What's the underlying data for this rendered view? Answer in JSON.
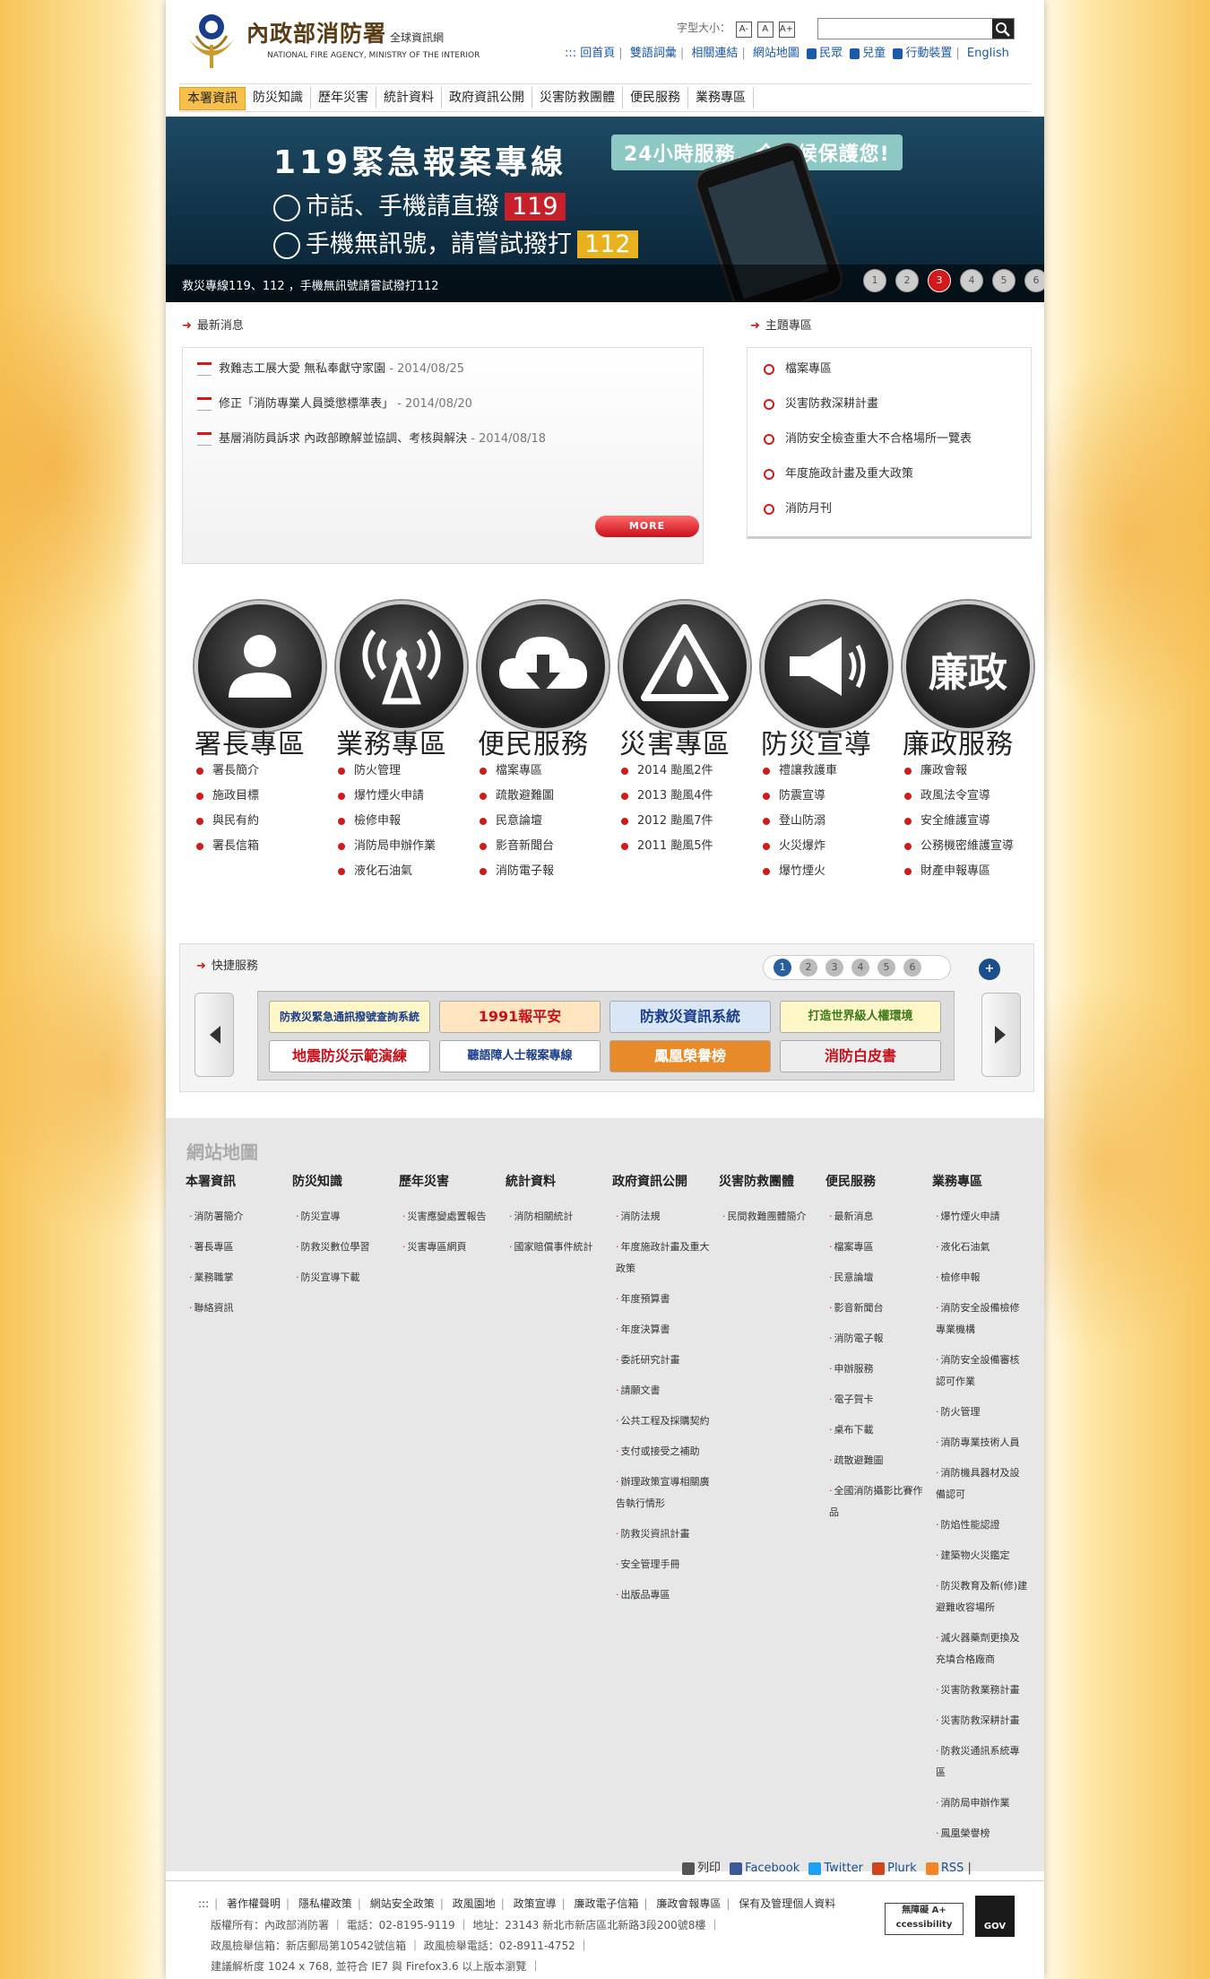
{
  "header": {
    "logo_title": "內政部消防署",
    "logo_suffix": "全球資訊網",
    "logo_subtitle": "NATIONAL FIRE AGENCY, MINISTRY OF THE INTERIOR",
    "font_size_label": "字型大小：",
    "font_buttons": [
      "A-",
      "A",
      "A+"
    ],
    "search_placeholder": "",
    "top_links": [
      "::: 回首頁",
      "雙語詞彙",
      "相關連結",
      "網站地圖",
      "民眾",
      "兒童",
      "行動裝置",
      "English"
    ]
  },
  "nav": [
    "本署資訊",
    "防災知識",
    "歷年災害",
    "統計資料",
    "政府資訊公開",
    "災害防救團體",
    "便民服務",
    "業務專區"
  ],
  "banner": {
    "title": "119緊急報案專線",
    "tag": "24小時服務．全天候保護您!",
    "line1": "市話、手機請直撥",
    "line1_num": "119",
    "line2": "手機無訊號，請嘗試撥打",
    "line2_num": "112",
    "caption": "救災專線119、112 ，手機無訊號請嘗試撥打112",
    "slides": [
      "1",
      "2",
      "3",
      "4",
      "5",
      "6"
    ],
    "active_slide": 3
  },
  "news": {
    "heading": "最新消息",
    "items": [
      {
        "text": "救難志工展大愛 無私奉獻守家園",
        "date": " - 2014/08/25"
      },
      {
        "text": "修正「消防專業人員獎懲標準表」",
        "date": " - 2014/08/20"
      },
      {
        "text": "基層消防員訴求 內政部瞭解並協調、考核與解決",
        "date": " - 2014/08/18"
      }
    ],
    "more": "MORE"
  },
  "topics": {
    "heading": "主題專區",
    "items": [
      "檔案專區",
      "災害防救深耕計畫",
      "消防安全檢查重大不合格場所一覽表",
      "年度施政計畫及重大政策",
      "消防月刊"
    ]
  },
  "services": [
    {
      "title": "署長專區",
      "icon": "person-icon",
      "links": [
        "署長簡介",
        "施政目標",
        "與民有約",
        "署長信箱"
      ]
    },
    {
      "title": "業務專區",
      "icon": "antenna-icon",
      "links": [
        "防火管理",
        "爆竹煙火申請",
        "檢修申報",
        "消防局申辦作業",
        "液化石油氣"
      ]
    },
    {
      "title": "便民服務",
      "icon": "cloud-download-icon",
      "links": [
        "檔案專區",
        "疏散避難圖",
        "民意論壇",
        "影音新聞台",
        "消防電子報"
      ]
    },
    {
      "title": "災害專區",
      "icon": "fire-warning-icon",
      "links": [
        "2014 颱風2件",
        "2013 颱風4件",
        "2012 颱風7件",
        "2011 颱風5件"
      ]
    },
    {
      "title": "防災宣導",
      "icon": "megaphone-icon",
      "links": [
        "禮讓救護車",
        "防震宣導",
        "登山防溺",
        "火災爆炸",
        "爆竹煙火"
      ]
    },
    {
      "title": "廉政服務",
      "icon": "integrity-icon",
      "icon_text": "廉政",
      "links": [
        "廉政會報",
        "政風法令宣導",
        "安全維護宣導",
        "公務機密維護宣導",
        "財產申報專區"
      ]
    }
  ],
  "quick": {
    "heading": "快捷服務",
    "pages": [
      "1",
      "2",
      "3",
      "4",
      "5",
      "6"
    ],
    "plus": "+",
    "tiles": [
      "防救災緊急通訊撥號查詢系統",
      "1991報平安",
      "防救災資訊系統",
      "打造世界級人權環境",
      "地震防災示範演練",
      "聽語障人士報案專線",
      "鳳凰榮譽榜",
      "消防白皮書"
    ]
  },
  "sitemap": {
    "title": "網站地圖",
    "columns": [
      {
        "head": "本署資訊",
        "links": [
          "消防署簡介",
          "署長專區",
          "業務職掌",
          "聯絡資訊"
        ]
      },
      {
        "head": "防災知識",
        "links": [
          "防災宣導",
          "防救災數位學習",
          "防災宣導下載"
        ]
      },
      {
        "head": "歷年災害",
        "links": [
          "災害應變處置報告",
          "災害專區網頁"
        ]
      },
      {
        "head": "統計資料",
        "links": [
          "消防相關統計",
          "國家賠償事件統計"
        ]
      },
      {
        "head": "政府資訊公開",
        "links": [
          "消防法規",
          "年度施政計畫及重大政策",
          "年度預算書",
          "年度決算書",
          "委託研究計畫",
          "請願文書",
          "公共工程及採購契約",
          "支付或接受之補助",
          "辦理政策宣導相關廣告執行情形",
          "防救災資訊計畫",
          "安全管理手冊",
          "出版品專區"
        ]
      },
      {
        "head": "災害防救團體",
        "links": [
          "民間救難團體簡介"
        ]
      },
      {
        "head": "便民服務",
        "links": [
          "最新消息",
          "檔案專區",
          "民意論壇",
          "影音新聞台",
          "消防電子報",
          "申辦服務",
          "電子賀卡",
          "桌布下載",
          "疏散避難圖",
          "全國消防攝影比賽作品"
        ]
      },
      {
        "head": "業務專區",
        "links": [
          "爆竹煙火申請",
          "液化石油氣",
          "檢修申報",
          "消防安全設備檢修專業機構",
          "消防安全設備審核認可作業",
          "防火管理",
          "消防專業技術人員",
          "消防機具器材及設備認可",
          "防焰性能認證",
          "建築物火災鑑定",
          "防災教育及新(修)建避難收容場所",
          "滅火器藥劑更換及充填合格廠商",
          "災害防救業務計畫",
          "災害防救深耕計畫",
          "防救災通訊系統專區",
          "消防局申辦作業",
          "鳳凰榮譽榜"
        ]
      }
    ]
  },
  "social": [
    "列印",
    "Facebook",
    "Twitter",
    "Plurk",
    "RSS"
  ],
  "footer": {
    "links": [
      ":::",
      "著作權聲明",
      "隱私權政策",
      "網站安全政策",
      "政風園地",
      "政策宣導",
      "廉政電子信箱",
      "廉政會報專區",
      "保有及管理個人資料"
    ],
    "lines": [
      "版權所有：內政部消防署 ｜ 電話：02-8195-9119 ｜ 地址：23143 新北市新店區北新路3段200號8樓 ｜",
      "政風檢舉信箱：新店郵局第10542號信箱 ｜ 政風檢舉電話：02-8911-4752 ｜",
      "建議解析度 1024 x 768, 並符合 IE7 與 Firefox3.6 以上版本瀏覽 ｜"
    ],
    "badge_accessibility": "無障礙 A+ ccessibility",
    "badge_gov": "GOV"
  },
  "colors": {
    "accent_red": "#d21a1a",
    "nav_active": "#f7c04a",
    "link_blue": "#1a5aa8"
  }
}
